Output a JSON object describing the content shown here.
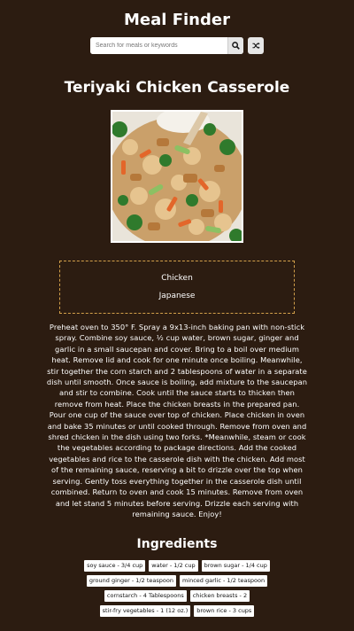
{
  "header": {
    "title": "Meal Finder",
    "search_placeholder": "Search for meals or keywords",
    "search_icon": "search-icon",
    "random_icon": "shuffle-icon"
  },
  "meal": {
    "title": "Teriyaki Chicken Casserole",
    "image_alt": "Teriyaki Chicken Casserole",
    "category": "Chicken",
    "area": "Japanese",
    "instructions": "Preheat oven to 350° F. Spray a 9x13-inch baking pan with non-stick spray. Combine soy sauce, ½ cup water, brown sugar, ginger and garlic in a small saucepan and cover. Bring to a boil over medium heat. Remove lid and cook for one minute once boiling. Meanwhile, stir together the corn starch and 2 tablespoons of water in a separate dish until smooth. Once sauce is boiling, add mixture to the saucepan and stir to combine. Cook until the sauce starts to thicken then remove from heat. Place the chicken breasts in the prepared pan. Pour one cup of the sauce over top of chicken. Place chicken in oven and bake 35 minutes or until cooked through. Remove from oven and shred chicken in the dish using two forks. *Meanwhile, steam or cook the vegetables according to package directions. Add the cooked vegetables and rice to the casserole dish with the chicken. Add most of the remaining sauce, reserving a bit to drizzle over the top when serving. Gently toss everything together in the casserole dish until combined. Return to oven and cook 15 minutes. Remove from oven and let stand 5 minutes before serving. Drizzle each serving with remaining sauce. Enjoy!",
    "ingredients_title": "Ingredients",
    "ingredients": [
      "soy sauce - 3/4 cup",
      "water - 1/2 cup",
      "brown sugar - 1/4 cup",
      "ground ginger - 1/2 teaspoon",
      "minced garlic - 1/2 teaspoon",
      "cornstarch - 4 Tablespoons",
      "chicken breasts - 2",
      "stir-fry vegetables - 1 (12 oz.)",
      "brown rice - 3 cups"
    ]
  },
  "colors": {
    "background": "#2c1c11",
    "tag_border": "#d3a04a",
    "text": "#ffffff"
  }
}
